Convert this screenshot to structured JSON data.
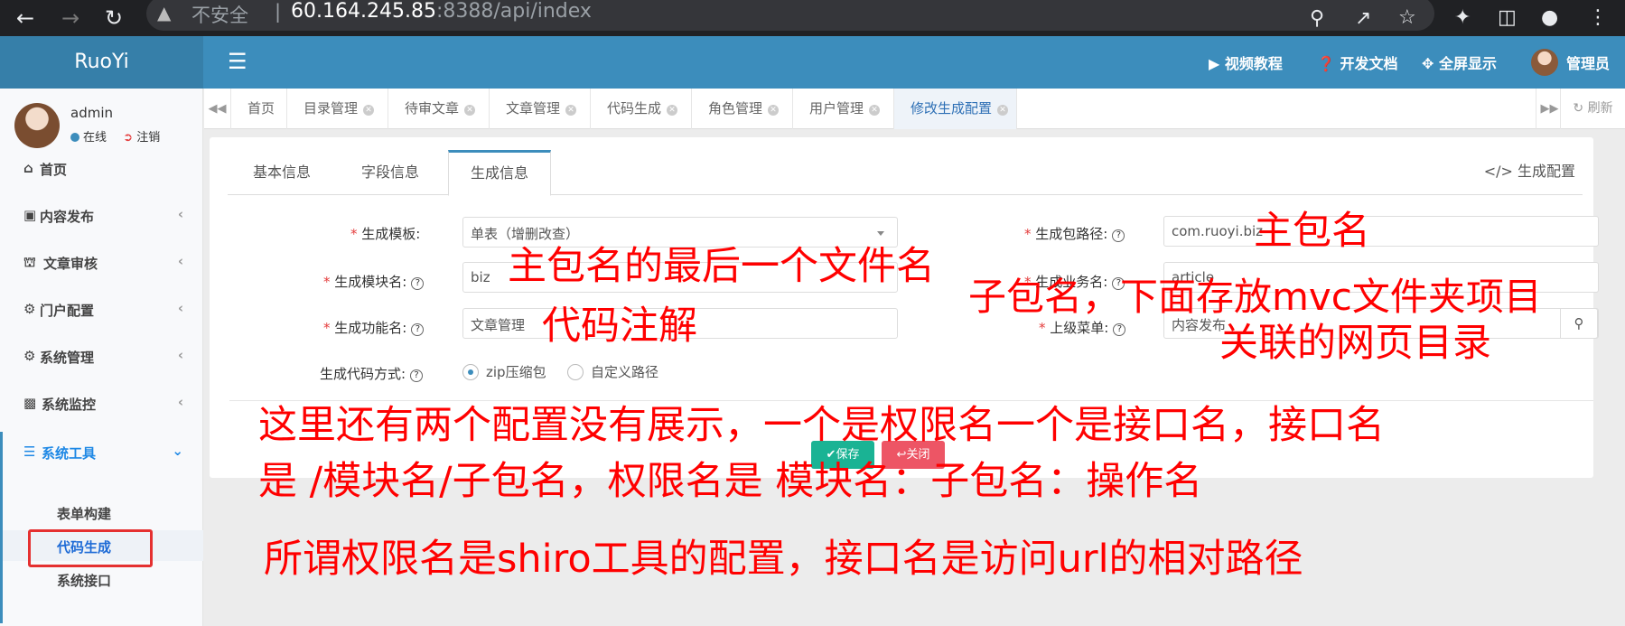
{
  "browser": {
    "security_label": "不安全",
    "url_host": "60.164.245.85",
    "url_rest": ":8388/api/index"
  },
  "header": {
    "logo": "RuoYi",
    "links": [
      "视频教程",
      "开发文档",
      "全屏显示"
    ],
    "user": "管理员"
  },
  "sidebar": {
    "username": "admin",
    "status": "在线",
    "logout": "注销",
    "menu": [
      "首页",
      "内容发布",
      "文章审核",
      "门户配置",
      "系统管理",
      "系统监控",
      "系统工具"
    ],
    "submenu": [
      "表单构建",
      "代码生成",
      "系统接口"
    ]
  },
  "tabs": {
    "items": [
      "首页",
      "目录管理",
      "待审文章",
      "文章管理",
      "代码生成",
      "角色管理",
      "用户管理",
      "修改生成配置"
    ],
    "refresh": "刷新"
  },
  "card": {
    "tabs": [
      "基本信息",
      "字段信息",
      "生成信息"
    ],
    "config_link": "生成配置",
    "fields": {
      "template_label": "生成模板:",
      "template_value": "单表（增删改查）",
      "package_label": "生成包路径:",
      "package_value": "com.ruoyi.biz",
      "module_label": "生成模块名:",
      "module_value": "biz",
      "business_label": "生成业务名:",
      "business_value": "article",
      "function_label": "生成功能名:",
      "function_value": "文章管理",
      "parent_menu_label": "上级菜单:",
      "parent_menu_value": "内容发布",
      "gen_type_label": "生成代码方式:",
      "gen_type_options": [
        "zip压缩包",
        "自定义路径"
      ]
    },
    "buttons": {
      "save": "保存",
      "close": "关闭"
    }
  },
  "annotations": [
    "主包名",
    "主包名的最后一个文件名",
    "子包名，下面存放mvc文件夹项目",
    "代码注解",
    "关联的网页目录",
    "这里还有两个配置没有展示，一个是权限名一个是接口名，接口名",
    "是 /模块名/子包名，权限名是 模块名：子包名：操作名",
    "所谓权限名是shiro工具的配置，接口名是访问url的相对路径"
  ],
  "colors": {
    "brand": "#3c8dbc",
    "annotation": "#ff0000",
    "required": "#e43c3c"
  }
}
